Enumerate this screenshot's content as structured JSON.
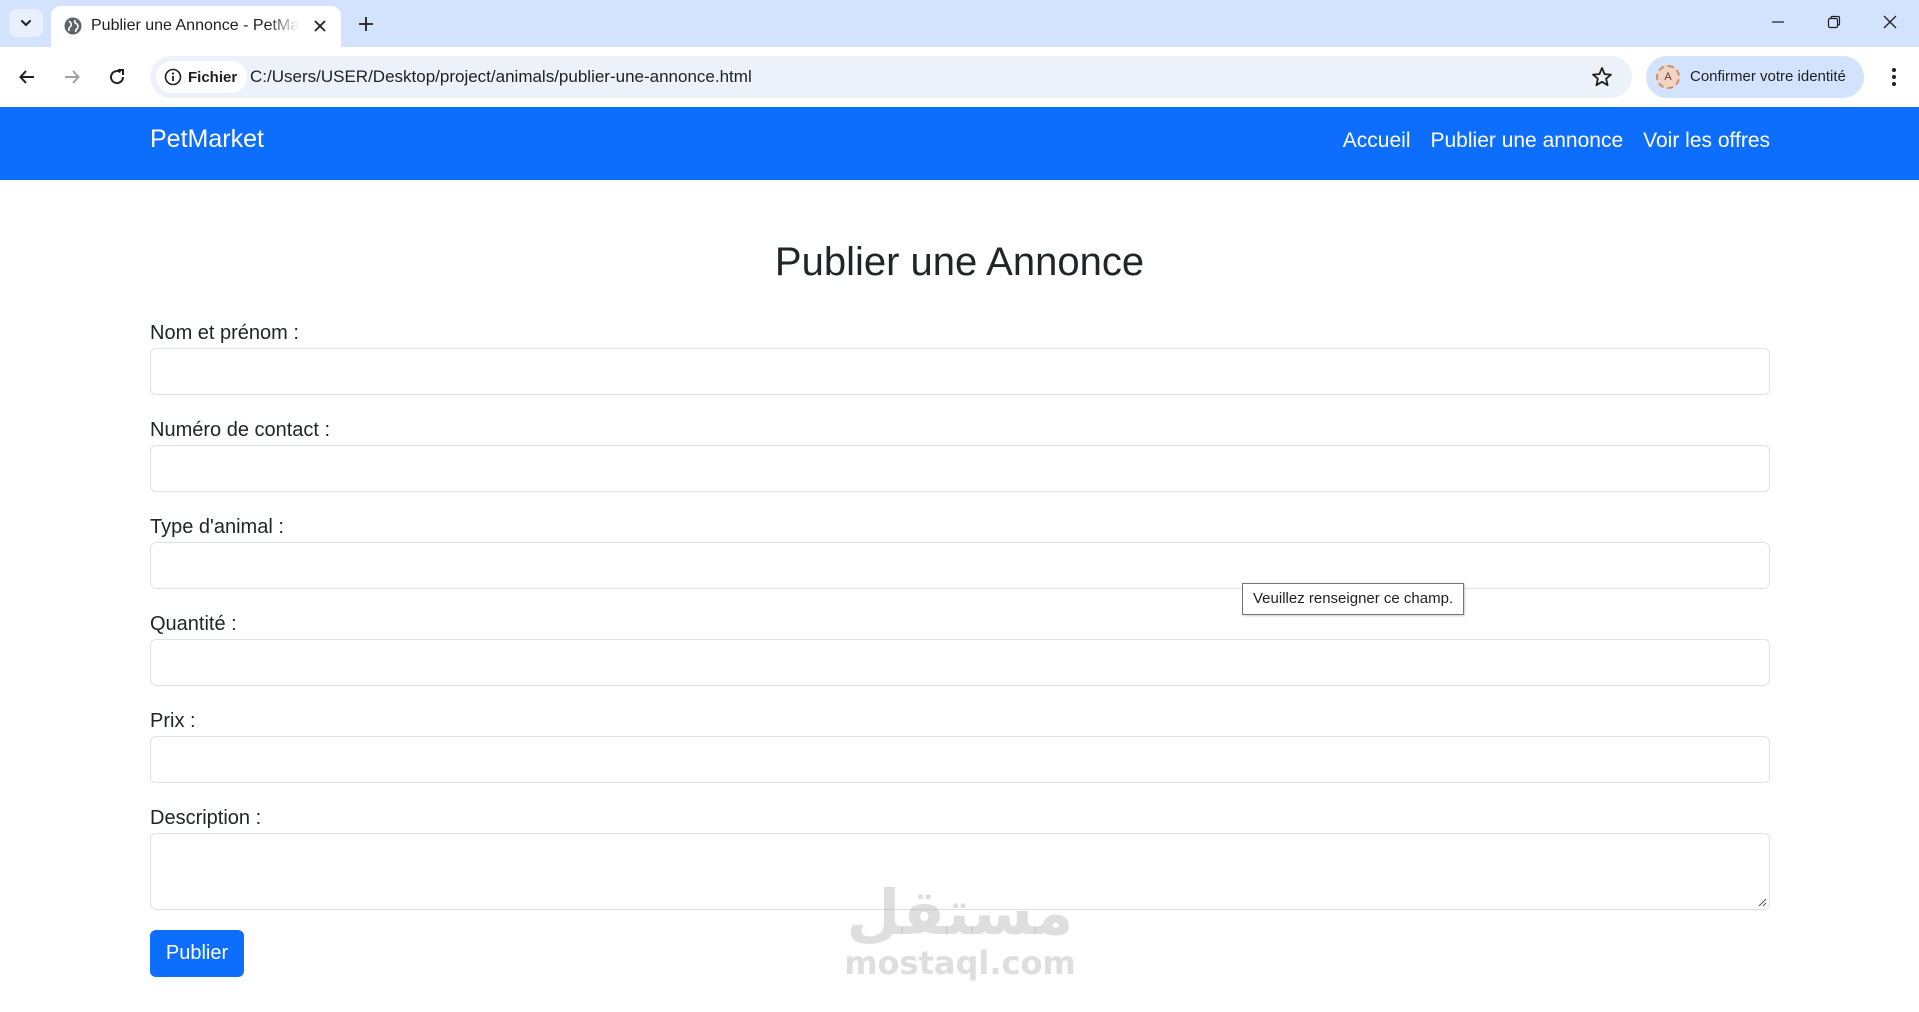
{
  "browser": {
    "tab": {
      "title": "Publier une Annonce - PetMarket"
    },
    "site_chip_label": "Fichier",
    "url": "C:/Users/USER/Desktop/project/animals/publier-une-annonce.html",
    "profile": {
      "avatar_letter": "A",
      "label": "Confirmer votre identité"
    }
  },
  "navbar": {
    "brand": "PetMarket",
    "links": [
      "Accueil",
      "Publier une annonce",
      "Voir les offres"
    ],
    "color": "#0d6efd"
  },
  "page": {
    "title": "Publier une Annonce",
    "fields": [
      {
        "label": "Nom et prénom :",
        "value": ""
      },
      {
        "label": "Numéro de contact :",
        "value": ""
      },
      {
        "label": "Type d'animal :",
        "value": ""
      },
      {
        "label": "Quantité :",
        "value": ""
      },
      {
        "label": "Prix :",
        "value": ""
      },
      {
        "label": "Description :",
        "value": ""
      }
    ],
    "validation_tooltip": "Veuillez renseigner ce champ.",
    "submit_label": "Publier"
  },
  "watermark": {
    "arabic": "مستقل",
    "latin": "mostaql.com"
  }
}
